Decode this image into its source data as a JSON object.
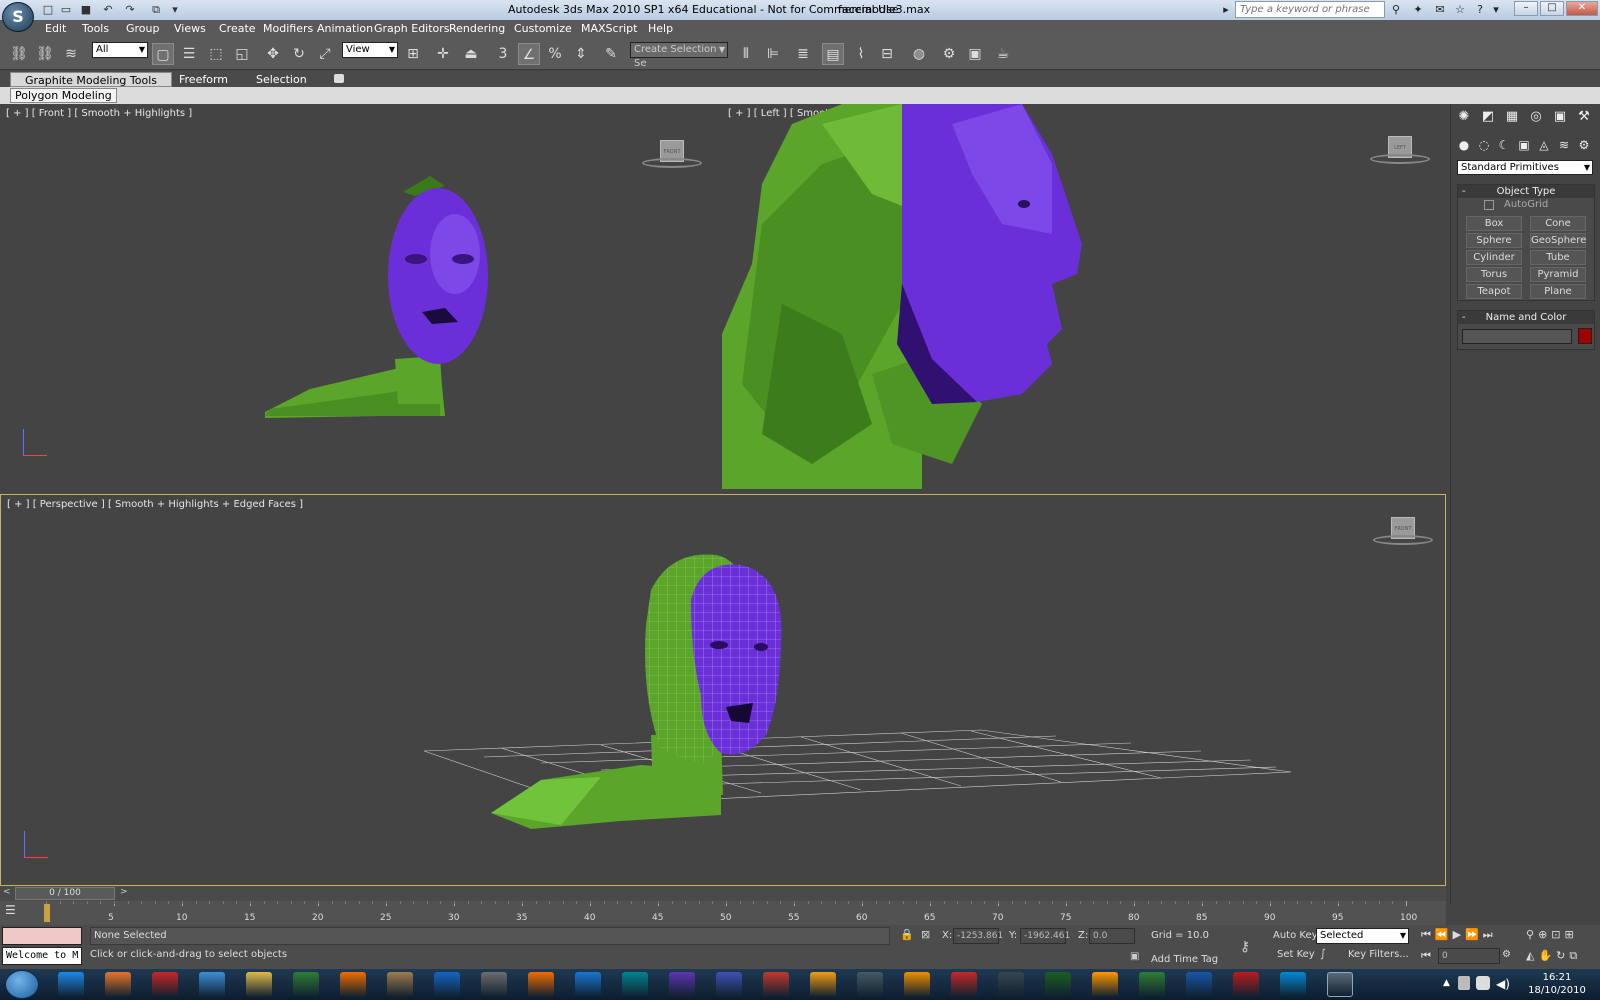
{
  "window": {
    "title": "Autodesk 3ds Max  2010 SP1 x64   Educational - Not for Commercial Use",
    "file": "facemodle3.max",
    "search_placeholder": "Type a keyword or phrase",
    "logo": "3ds-max-logo"
  },
  "menu": [
    "Edit",
    "Tools",
    "Group",
    "Views",
    "Create",
    "Modifiers",
    "Animation",
    "Graph Editors",
    "Rendering",
    "Customize",
    "MAXScript",
    "Help"
  ],
  "toolbar": {
    "filter": "All",
    "ref_coord": "View",
    "selection_set": "Create Selection Se",
    "snap_label": "3"
  },
  "ribbon": {
    "tabs": [
      "Graphite Modeling Tools",
      "Freeform",
      "Selection"
    ],
    "panel": "Polygon Modeling"
  },
  "viewports": {
    "front": {
      "label": "[ + ] [ Front ] [ Smooth + Highlights ]",
      "cube": "FRONT"
    },
    "left": {
      "label": "[ + ] [ Left ] [ Smooth + Highlights ]",
      "cube": "LEFT"
    },
    "perspective": {
      "label": "[ + ] [ Perspective ] [ Smooth + Highlights + Edged Faces ]",
      "cube": "FRONT"
    }
  },
  "command_panel": {
    "category": "Standard Primitives",
    "object_type": {
      "title": "Object Type",
      "autogrid": "AutoGrid",
      "buttons": [
        "Box",
        "Cone",
        "Sphere",
        "GeoSphere",
        "Cylinder",
        "Tube",
        "Torus",
        "Pyramid",
        "Teapot",
        "Plane"
      ]
    },
    "name_color": {
      "title": "Name and Color",
      "swatch": "#a00000"
    }
  },
  "timeline": {
    "frame": "0 / 100",
    "ticks": [
      "5",
      "10",
      "15",
      "20",
      "25",
      "30",
      "35",
      "40",
      "45",
      "50",
      "55",
      "60",
      "65",
      "70",
      "75",
      "80",
      "85",
      "90",
      "95",
      "100"
    ]
  },
  "status": {
    "listener": "Welcome to M",
    "selection": "None Selected",
    "prompt": "Click or click-and-drag to select objects",
    "x_label": "X:",
    "x": "-1253.861",
    "y_label": "Y:",
    "y": "-1962.461",
    "z_label": "Z:",
    "z": "0.0",
    "grid": "Grid = 10.0",
    "add_time_tag": "Add Time Tag",
    "auto_key": "Auto Key",
    "selected": "Selected",
    "set_key": "Set Key",
    "key_filters": "Key Filters...",
    "frame_field": "0"
  },
  "taskbar": {
    "time": "16:21",
    "date": "18/10/2010",
    "apps": [
      "ie",
      "firefox",
      "opera",
      "safari",
      "explorer",
      "media-player",
      "vlc",
      "paint",
      "photoshop",
      "gimp",
      "blender",
      "matlab",
      "app",
      "infinity",
      "virtualbox",
      "office",
      "sed",
      "chart",
      "scratch",
      "pen",
      "vw",
      "tools",
      "swirl",
      "publisher",
      "word",
      "pdf",
      "quicktime",
      "3ds-max"
    ]
  },
  "colors": {
    "viewport_bg": "#444444",
    "head_purple": "#6a2fd8",
    "body_green": "#5aa52a",
    "active_border": "#c9b25a"
  }
}
